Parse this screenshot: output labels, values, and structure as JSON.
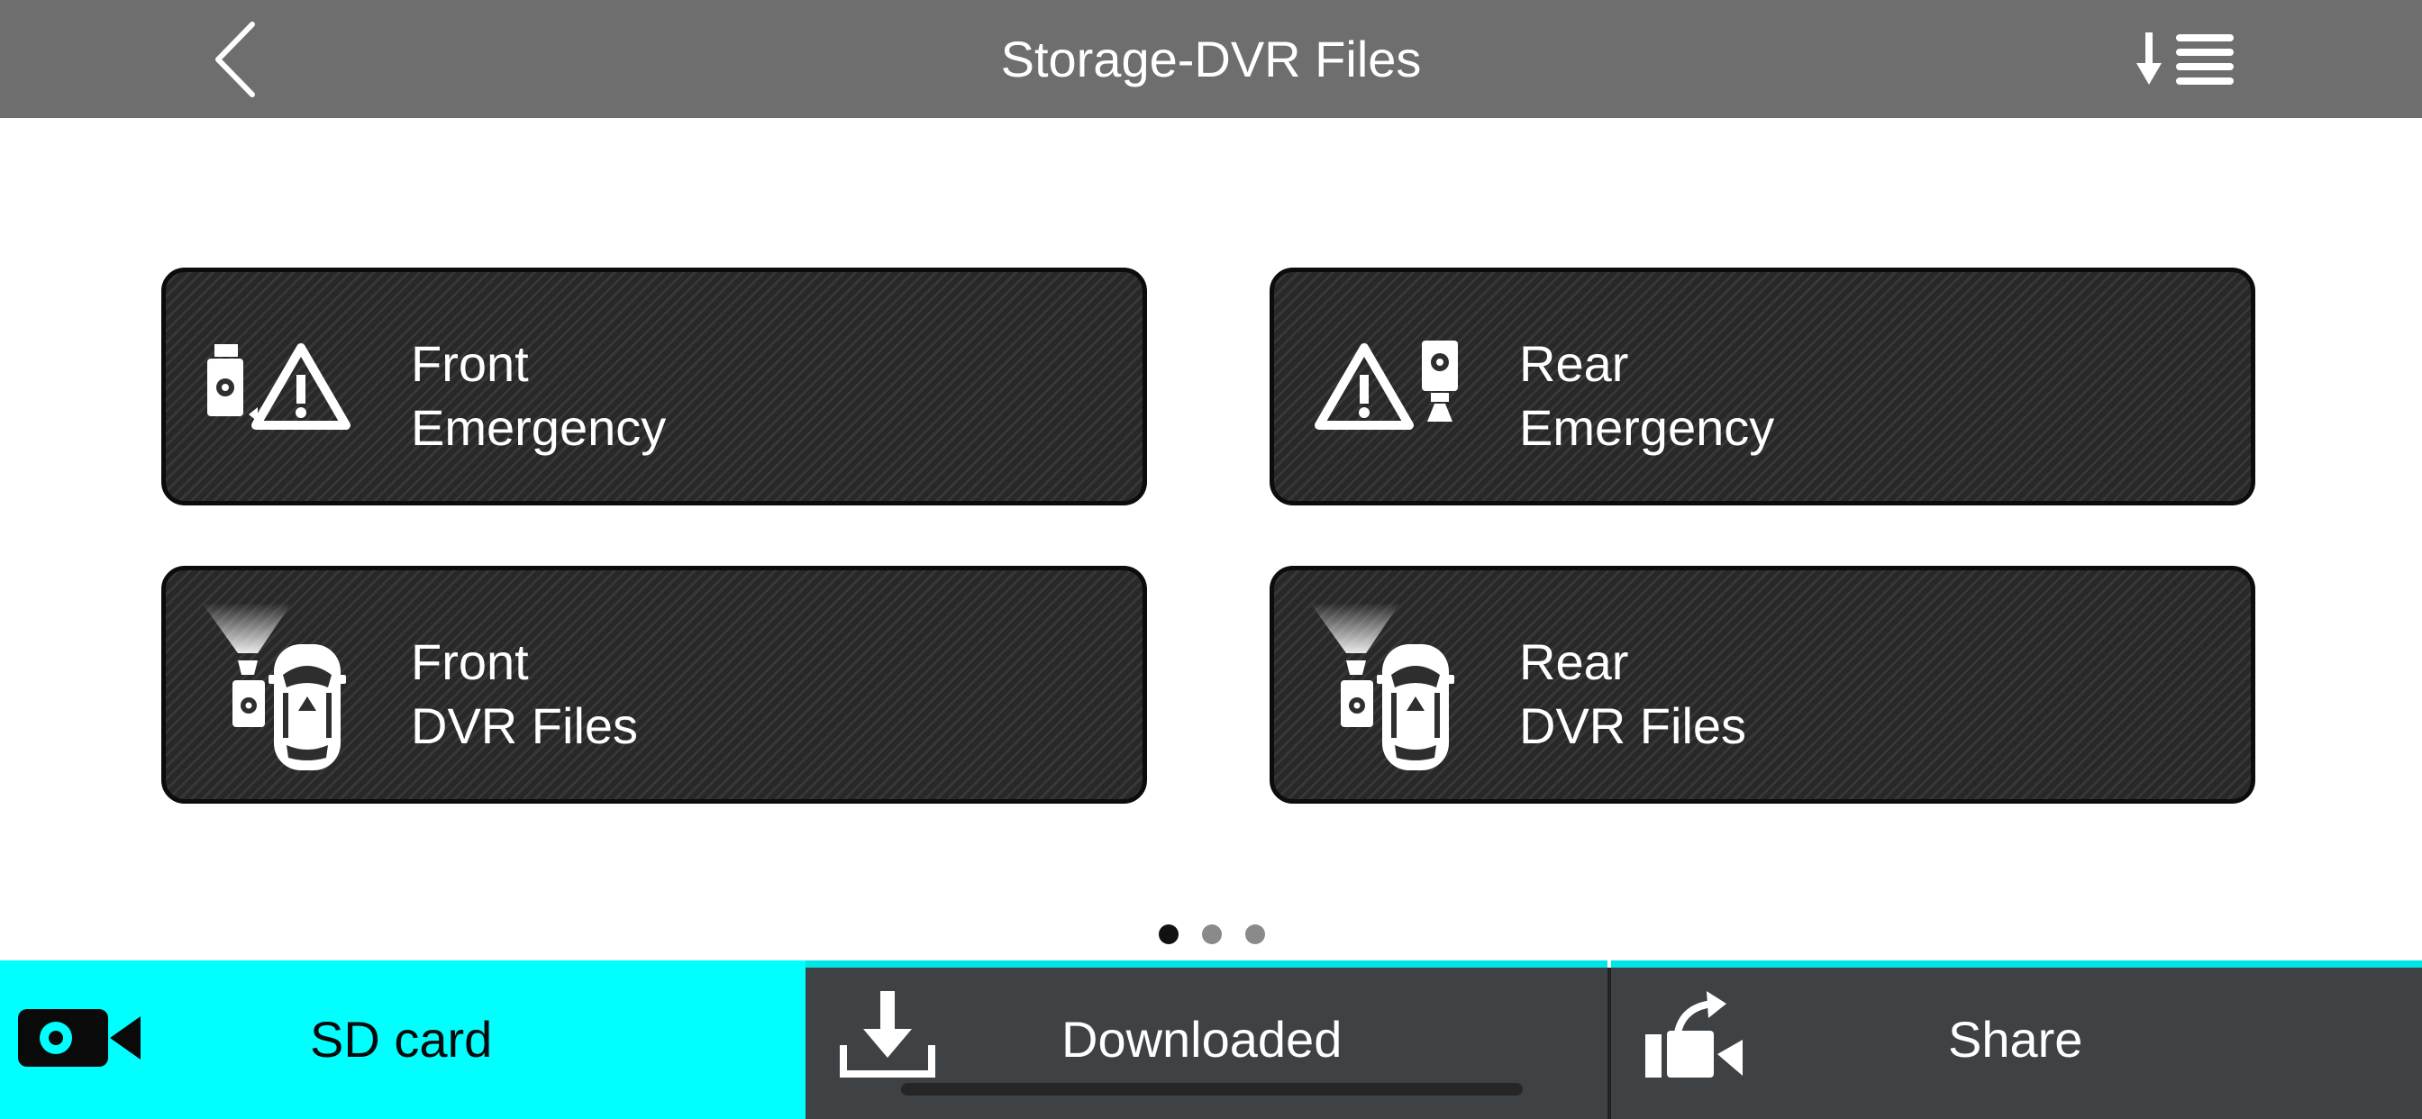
{
  "header": {
    "title": "Storage-DVR Files",
    "back_icon": "chevron-left-icon",
    "sort_icon": "sort-list-icon"
  },
  "tiles": [
    {
      "line1": "Front",
      "line2": "Emergency",
      "icon": "front-camera-warning-icon"
    },
    {
      "line1": "Rear",
      "line2": "Emergency",
      "icon": "warning-rear-camera-icon"
    },
    {
      "line1": "Front",
      "line2": "DVR Files",
      "icon": "front-dashcam-car-icon"
    },
    {
      "line1": "Rear",
      "line2": "DVR Files",
      "icon": "rear-dashcam-car-icon"
    }
  ],
  "pager": {
    "pages": 3,
    "current": 1
  },
  "tabs": [
    {
      "label": "SD card",
      "icon": "video-camera-icon",
      "selected": true
    },
    {
      "label": "Downloaded",
      "icon": "download-icon",
      "selected": false
    },
    {
      "label": "Share",
      "icon": "share-icon",
      "selected": false
    }
  ],
  "colors": {
    "header_bg": "#6e6e6e",
    "accent_cyan": "#00ffff",
    "tile_bg": "#2e2e2e",
    "tab_bg": "#3e4245"
  }
}
